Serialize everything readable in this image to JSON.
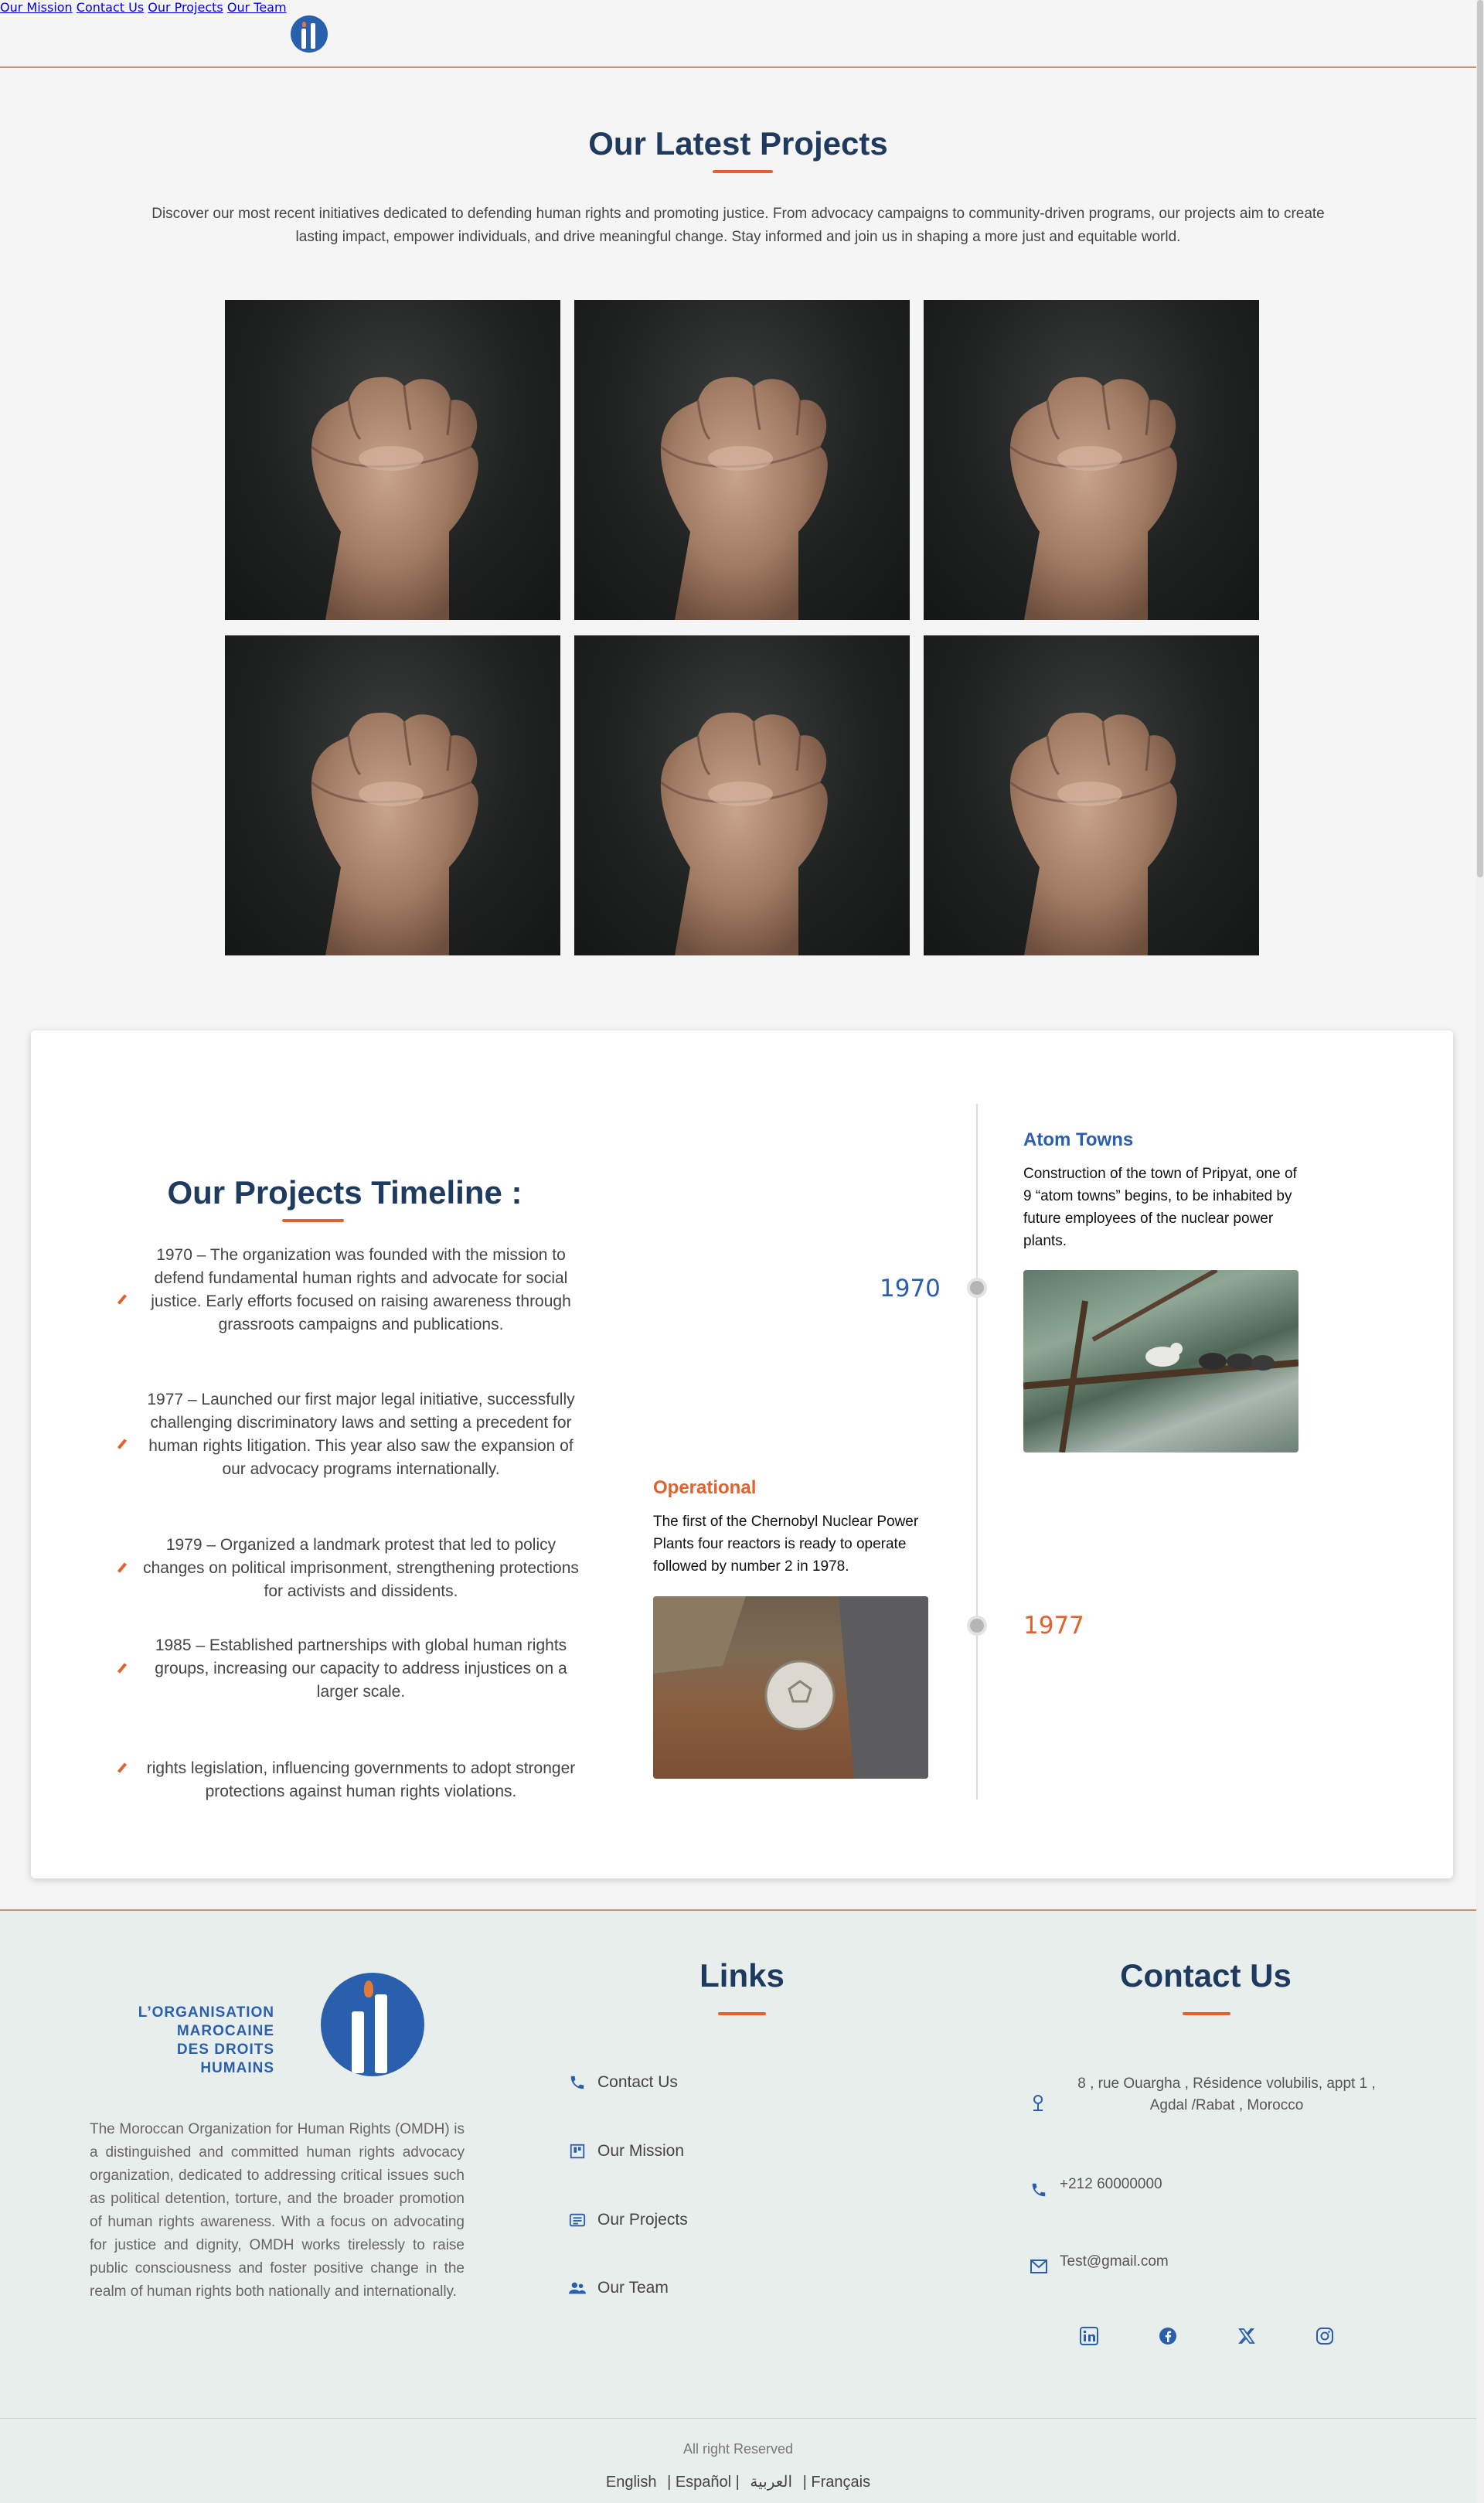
{
  "nav": {
    "items": [
      "Our Mission",
      "Contact Us",
      "Our Projects",
      "Our Team"
    ]
  },
  "latest": {
    "title": "Our Latest Projects",
    "intro": "Discover our most recent initiatives dedicated to defending human rights and promoting justice. From advocacy campaigns to community-driven programs, our projects aim to create lasting impact, empower individuals, and drive meaningful change. Stay informed and join us in shaping a more just and equitable world."
  },
  "timeline": {
    "title": "Our Projects Timeline :",
    "items": [
      "1970 – The organization was founded with the mission to defend fundamental human rights and advocate for social justice. Early efforts focused on raising awareness through grassroots campaigns and publications.",
      "1977 – Launched our first major legal initiative, successfully challenging discriminatory laws and setting a precedent for human rights litigation. This year also saw the expansion of our advocacy programs internationally.",
      "1979 – Organized a landmark protest that led to policy changes on political imprisonment, strengthening protections for activists and dissidents.",
      "1985 – Established partnerships with global human rights groups, increasing our capacity to address injustices on a larger scale.",
      "rights legislation, influencing governments to adopt stronger protections against human rights violations."
    ],
    "events": [
      {
        "year": "1970",
        "title": "Atom Towns",
        "text": "Construction of the town of Pripyat, one of 9 “atom towns” begins, to be inhabited by future employees of the nuclear power plants."
      },
      {
        "year": "1977",
        "title": "Operational",
        "text": "The first of the Chernobyl Nuclear Power Plants four reactors is ready to operate followed by number 2 in 1978."
      }
    ],
    "colors": {
      "blue": "#2a5fad",
      "orange": "#e2612e"
    }
  },
  "footer": {
    "brand_lines": [
      "L’ORGANISATION",
      "MAROCAINE",
      "DES DROITS HUMAINS"
    ],
    "about": "The Moroccan Organization for Human Rights (OMDH) is a distinguished and committed human rights advocacy organization, dedicated to addressing critical issues such as political detention, torture, and the broader promotion of human rights awareness. With a focus on advocating for justice and dignity, OMDH works tirelessly to raise public consciousness and foster positive change in the realm of human rights both nationally and internationally.",
    "links_title": "Links",
    "links": [
      {
        "label": "Contact Us",
        "icon": "phone-icon"
      },
      {
        "label": "Our Mission",
        "icon": "mission-icon"
      },
      {
        "label": "Our Projects",
        "icon": "projects-icon"
      },
      {
        "label": "Our Team",
        "icon": "team-icon"
      }
    ],
    "contact_title": "Contact Us",
    "address": "8 , rue Ouargha , Résidence volubilis, appt 1 , Agdal /Rabat , Morocco",
    "phone": "+212 60000000",
    "email": "Test@gmail.com",
    "social": [
      "linkedin-icon",
      "facebook-icon",
      "x-icon",
      "instagram-icon"
    ],
    "rights": "All right Reserved",
    "languages": [
      "English",
      "| Español |",
      "العربية",
      "| Français"
    ]
  }
}
